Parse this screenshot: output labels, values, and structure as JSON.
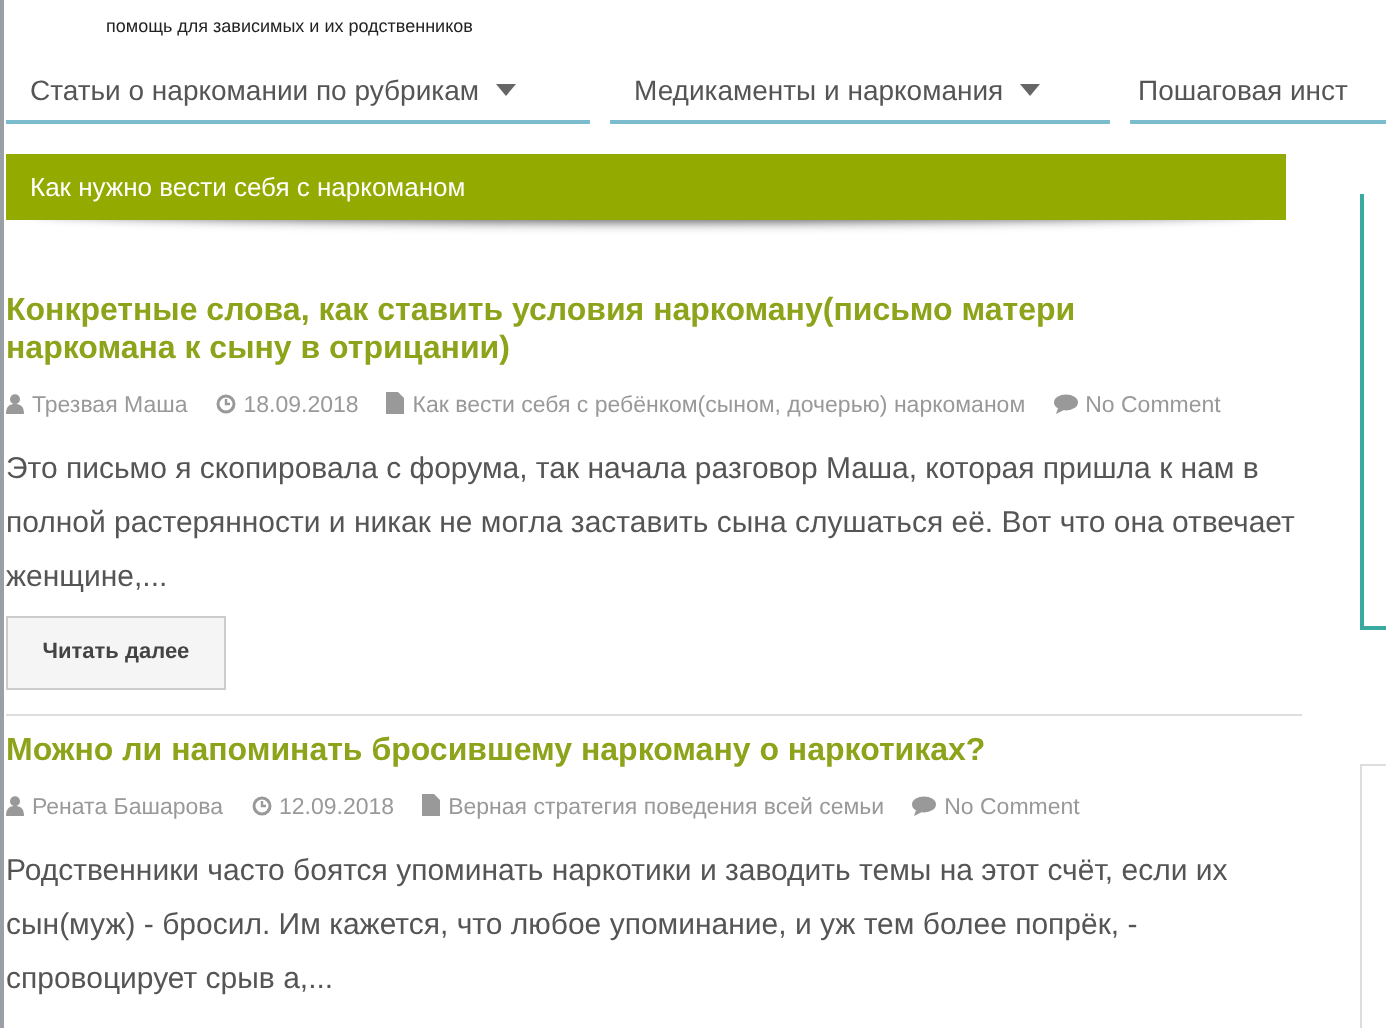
{
  "header": {
    "tagline": "помощь для зависимых и их родственников"
  },
  "nav": [
    {
      "label": "Статьи о наркомании по рубрикам",
      "has_dropdown": true
    },
    {
      "label": "Медикаменты и наркомания",
      "has_dropdown": true
    },
    {
      "label": "Пошаговая инст",
      "has_dropdown": false
    }
  ],
  "category_banner": "Как нужно вести себя с наркоманом",
  "posts": [
    {
      "title": "Конкретные слова, как ставить условия наркоману(письмо матери наркомана к сыну в отрицании)",
      "author": "Трезвая Маша",
      "date": "18.09.2018",
      "category": "Как вести себя с ребёнком(сыном, дочерью) наркоманом",
      "comments": "No Comment",
      "excerpt": "Это письмо я скопировала с форума, так начала разговор Маша, которая пришла к нам в полной растерянности и никак не могла заставить сына слушаться её.  Вот что она отвечает женщине,...",
      "button": "Читать далее"
    },
    {
      "title": "Можно ли напоминать бросившему наркоману о наркотиках?",
      "author": "Рената Башарова",
      "date": "12.09.2018",
      "category": "Верная стратегия поведения всей семьи",
      "comments": "No Comment",
      "excerpt": "Родственники часто боятся упоминать наркотики и заводить темы на этот счёт, если их сын(муж) - бросил.  Им кажется, что любое упоминание, и уж тем более попрёк, - спровоцирует срыв а,..."
    }
  ]
}
